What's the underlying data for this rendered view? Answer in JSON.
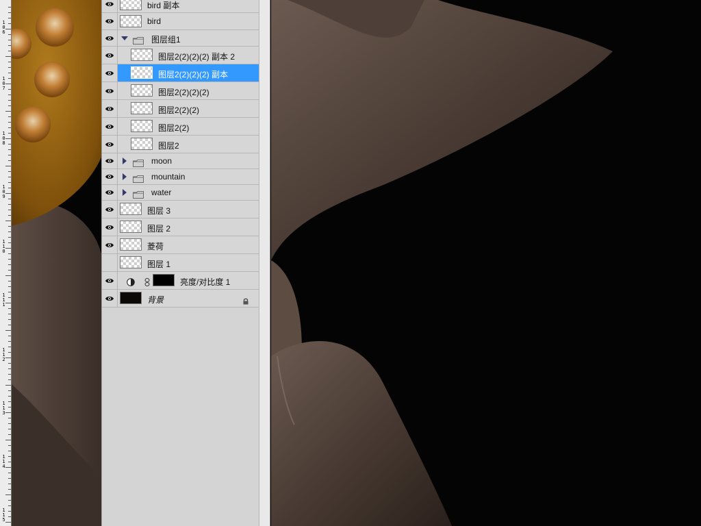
{
  "ruler": {
    "labels": [
      "1\n0\n6",
      "1\n0\n7",
      "1\n0\n8",
      "1\n0\n9",
      "1\n1\n0",
      "1\n1\n1",
      "1\n1\n2",
      "1\n1\n3",
      "1\n1\n4",
      "1\n1\n5"
    ]
  },
  "layers": [
    {
      "name": "bird 副本",
      "kind": "layer",
      "visible": true,
      "indent": 0
    },
    {
      "name": "bird",
      "kind": "layer",
      "visible": true,
      "indent": 0
    },
    {
      "name": "图层组1",
      "kind": "group-open",
      "visible": true,
      "indent": 0
    },
    {
      "name": "图层2(2)(2)(2) 副本 2",
      "kind": "layer",
      "visible": true,
      "indent": 1
    },
    {
      "name": "图层2(2)(2)(2) 副本",
      "kind": "layer",
      "visible": true,
      "indent": 1,
      "selected": true
    },
    {
      "name": "图层2(2)(2)(2)",
      "kind": "layer",
      "visible": true,
      "indent": 1
    },
    {
      "name": "图层2(2)(2)",
      "kind": "layer",
      "visible": true,
      "indent": 1
    },
    {
      "name": "图层2(2)",
      "kind": "layer",
      "visible": true,
      "indent": 1
    },
    {
      "name": "图层2",
      "kind": "layer",
      "visible": true,
      "indent": 1
    },
    {
      "name": "moon",
      "kind": "group-closed",
      "visible": true,
      "indent": 0
    },
    {
      "name": "mountain",
      "kind": "group-closed",
      "visible": true,
      "indent": 0
    },
    {
      "name": "water",
      "kind": "group-closed",
      "visible": true,
      "indent": 0
    },
    {
      "name": "图层 3",
      "kind": "layer",
      "visible": true,
      "indent": 0
    },
    {
      "name": "图层 2",
      "kind": "layer",
      "visible": true,
      "indent": 0
    },
    {
      "name": "菱荷",
      "kind": "layer",
      "visible": true,
      "indent": 0
    },
    {
      "name": "图层 1",
      "kind": "layer",
      "visible": false,
      "indent": 0
    },
    {
      "name": "亮度/对比度 1",
      "kind": "adjustment",
      "visible": true,
      "indent": 0
    },
    {
      "name": "背景",
      "kind": "background",
      "visible": true,
      "indent": 0,
      "locked": true
    }
  ],
  "colors": {
    "selection": "#3399ff",
    "panel": "#d6d6d6",
    "gold": "#8a5a0c"
  }
}
